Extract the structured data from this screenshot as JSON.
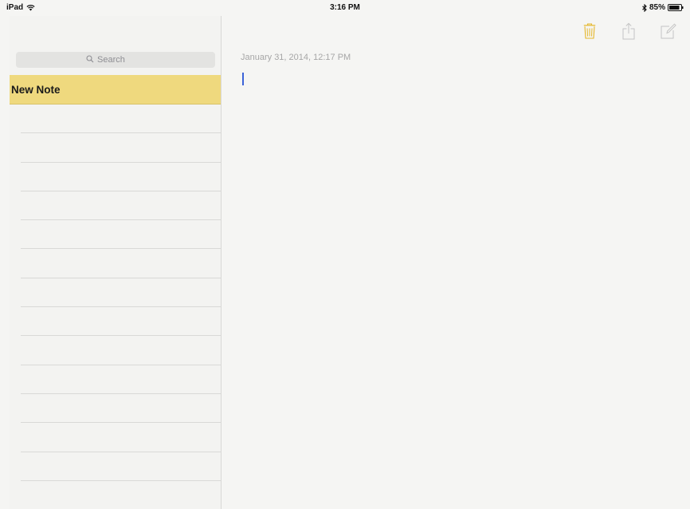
{
  "status_bar": {
    "device": "iPad",
    "time": "3:16 PM",
    "battery": "85%"
  },
  "sidebar": {
    "search": {
      "placeholder": "Search"
    },
    "notes": [
      {
        "title": "New Note",
        "selected": true
      }
    ]
  },
  "toolbar": {
    "buttons": [
      "trash-icon",
      "share-icon",
      "compose-icon"
    ],
    "accent_color": "#e5b629"
  },
  "note": {
    "date": "January 31, 2014, 12:17 PM",
    "body": ""
  },
  "colors": {
    "selected_row": "#efd97e",
    "cursor": "#3b63d8",
    "background": "#f5f5f3"
  }
}
